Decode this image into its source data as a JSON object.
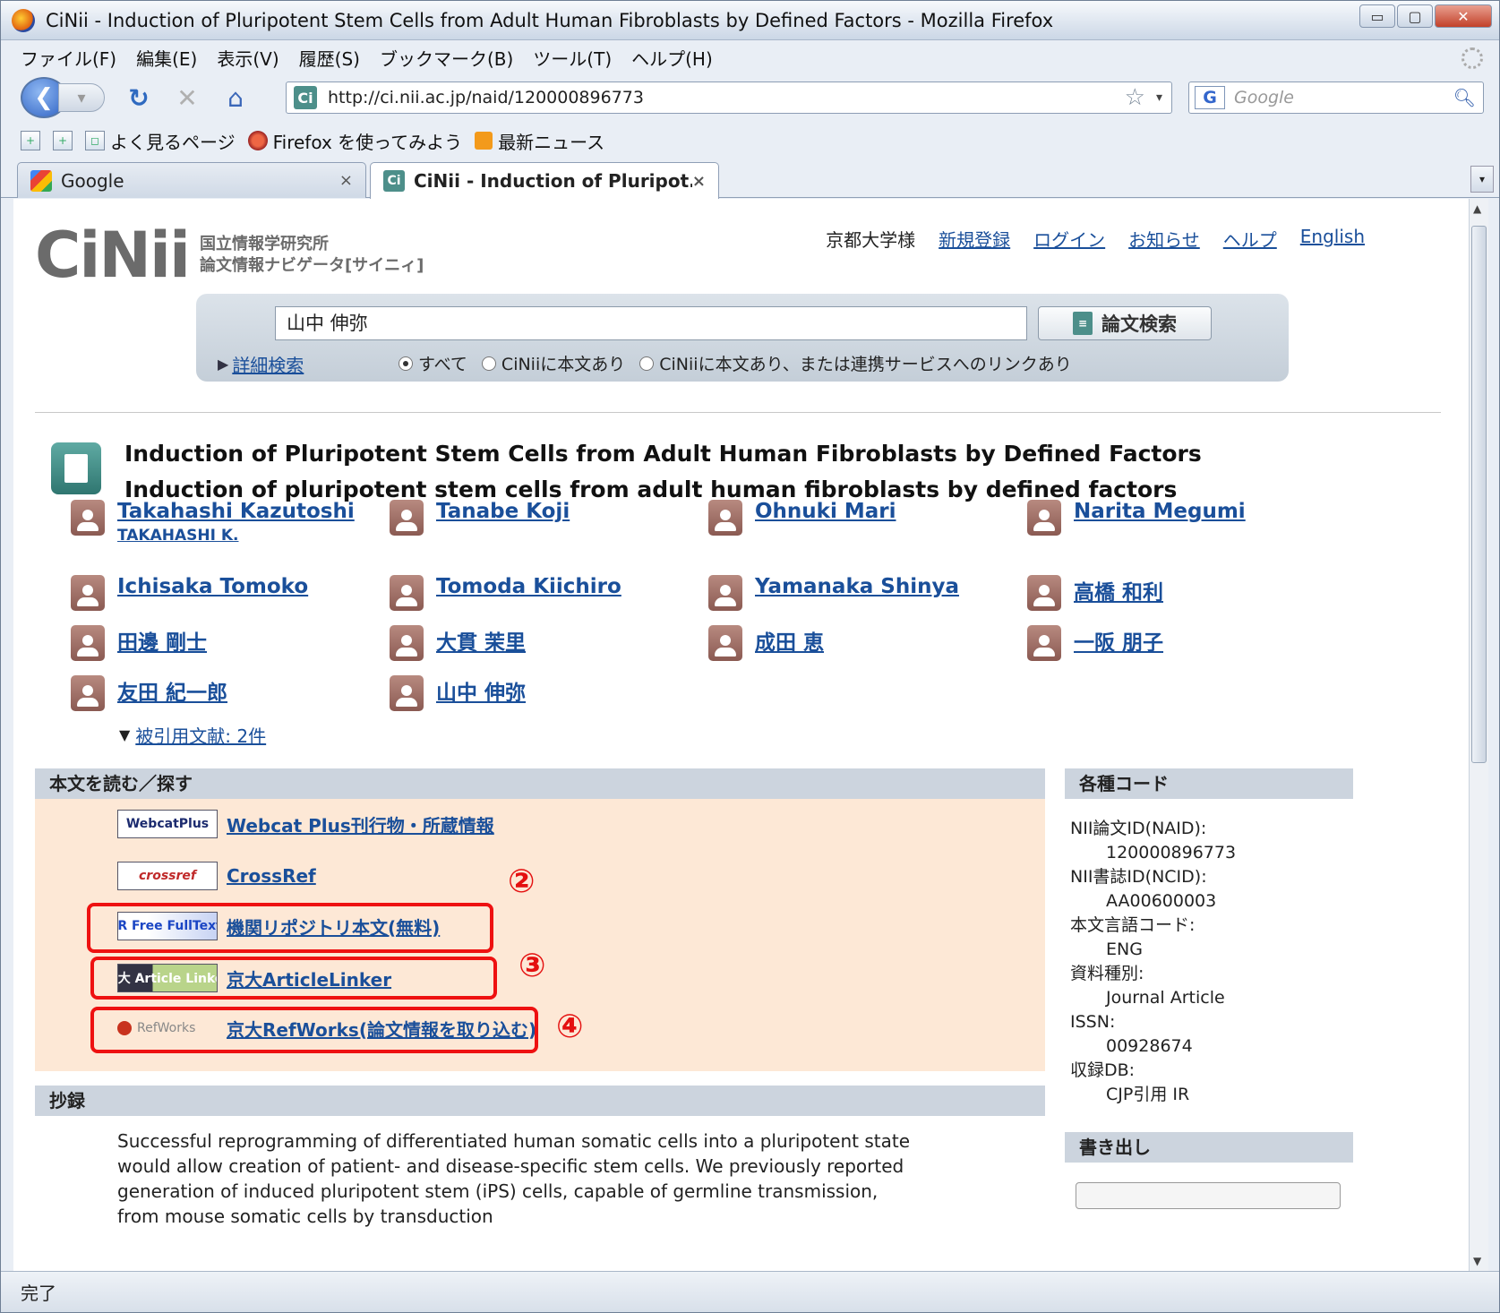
{
  "window": {
    "title": "CiNii -  Induction of Pluripotent Stem Cells from Adult Human Fibroblasts by Defined Factors - Mozilla Firefox",
    "min": "▭",
    "max": "▢",
    "close": "✕"
  },
  "menu": [
    "ファイル(F)",
    "編集(E)",
    "表示(V)",
    "履歴(S)",
    "ブックマーク(B)",
    "ツール(T)",
    "ヘルプ(H)"
  ],
  "nav": {
    "url": "http://ci.nii.ac.jp/naid/120000896773",
    "search_placeholder": "Google"
  },
  "bookmarks": [
    "よく見るページ",
    "Firefox を使ってみよう",
    "最新ニュース"
  ],
  "tabs": [
    {
      "label": "Google",
      "close": "×"
    },
    {
      "label": "CiNii -  Induction of Pluripot...",
      "close": "×"
    }
  ],
  "status": "完了",
  "header": {
    "logo": "CiNii",
    "logo_sub1": "国立情報学研究所",
    "logo_sub2": "論文情報ナビゲータ[サイニィ]",
    "user": "京都大学様",
    "links": [
      "新規登録",
      "ログイン",
      "お知らせ",
      "ヘルプ",
      "English"
    ]
  },
  "search": {
    "query": "山中 伸弥",
    "button": "論文検索",
    "advanced": "詳細検索",
    "options": [
      "すべて",
      "CiNiiに本文あり",
      "CiNiiに本文あり、または連携サービスへのリンクあり"
    ]
  },
  "article": {
    "title": "Induction of Pluripotent Stem Cells from Adult Human Fibroblasts by Defined Factors",
    "subtitle": "Induction of pluripotent stem cells from adult human fibroblasts by defined factors",
    "authors": [
      {
        "name": "Takahashi Kazutoshi",
        "alt": "TAKAHASHI K."
      },
      {
        "name": "Tanabe Koji"
      },
      {
        "name": "Ohnuki Mari"
      },
      {
        "name": "Narita Megumi"
      },
      {
        "name": "Ichisaka Tomoko"
      },
      {
        "name": "Tomoda Kiichiro"
      },
      {
        "name": "Yamanaka Shinya"
      },
      {
        "name": "高橋 和利"
      },
      {
        "name": "田邊 剛士"
      },
      {
        "name": "大貫 茉里"
      },
      {
        "name": "成田 恵"
      },
      {
        "name": "一阪 朋子"
      },
      {
        "name": "友田 紀一郎"
      },
      {
        "name": "山中 伸弥"
      }
    ],
    "cited_by": "被引用文献: 2件"
  },
  "fulltext": {
    "heading": "本文を読む／探す",
    "services": [
      {
        "logo": "WebcatPlus",
        "link": "Webcat Plus刊行物・所蔵情報"
      },
      {
        "logo": "crossref",
        "link": "CrossRef"
      },
      {
        "logo": "IR Free FullText",
        "link": "機関リポジトリ本文(無料)"
      },
      {
        "logo": "京大 Article Linker",
        "link": "京大ArticleLinker"
      },
      {
        "logo": "RefWorks",
        "link": "京大RefWorks(論文情報を取り込む)"
      }
    ],
    "markers": [
      "②",
      "③",
      "④"
    ]
  },
  "codes": {
    "heading": "各種コード",
    "items": [
      {
        "key": "NII論文ID(NAID):",
        "value": "120000896773"
      },
      {
        "key": "NII書誌ID(NCID):",
        "value": "AA00600003"
      },
      {
        "key": "本文言語コード:",
        "value": "ENG"
      },
      {
        "key": "資料種別:",
        "value": "Journal Article"
      },
      {
        "key": "ISSN:",
        "value": "00928674"
      },
      {
        "key": "収録DB:",
        "value": "CJP引用  IR"
      }
    ]
  },
  "abstract": {
    "heading": "抄録",
    "text": "Successful reprogramming of differentiated human somatic cells into a pluripotent state would allow creation of patient- and disease-specific stem cells. We previously reported generation of induced pluripotent stem (iPS) cells, capable of germline transmission, from mouse somatic cells by transduction"
  },
  "export": {
    "heading": "書き出し"
  },
  "colors": {
    "link": "#1a4f9a",
    "highlight": "#ee1111",
    "panel": "#fde8d6"
  }
}
